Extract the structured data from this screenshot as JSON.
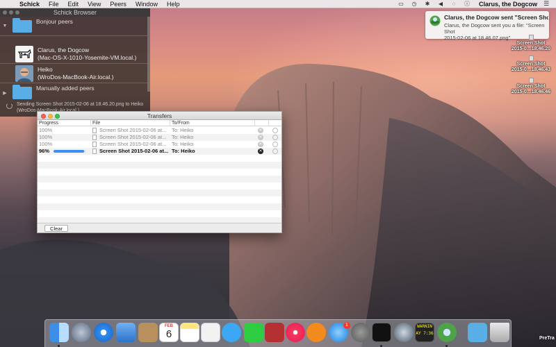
{
  "menubar": {
    "app_name": "Schick",
    "menus": [
      "File",
      "Edit",
      "View",
      "Peers",
      "Window",
      "Help"
    ],
    "user": "Clarus, the Dogcow"
  },
  "browser": {
    "title": "Schick Browser",
    "groups": [
      {
        "label": "Bonjour peers"
      },
      {
        "label": "Manually added peers"
      }
    ],
    "peers": [
      {
        "name": "Clarus, the Dogcow",
        "host": "(Mac-OS-X-1010-Yosemite-VM.local.)"
      },
      {
        "name": "Heiko",
        "host": "(WroDos-MacBook-Air.local.)"
      }
    ],
    "status_line1": "Sending Screen Shot 2015-02-06 at 18.46.20.png to Heiko",
    "status_line2": "(WroDos-MacBook-Air.local.)"
  },
  "notification": {
    "title": "Clarus, the Dogcow sent \"Screen Sho…",
    "body_line1": "Clarus, the Dogcow sent you a file: \"Screen Shot",
    "body_line2": "2015-02-06 at 18.46.07.png\""
  },
  "desktop_files": [
    {
      "line1": "Screen Shot",
      "line2": "2015-0…18.46.20"
    },
    {
      "line1": "Screen Shot",
      "line2": "2015-0…18.46.43"
    },
    {
      "line1": "Screen Shot",
      "line2": "2015-0…18.46.46"
    }
  ],
  "transfers": {
    "title": "Transfers",
    "columns": {
      "progress": "Progress",
      "file": "File",
      "to_from": "To/From"
    },
    "rows": [
      {
        "progress_label": "100%",
        "progress": 1.0,
        "file": "Screen Shot 2015-02-06 at...",
        "to_from": "To: Heiko",
        "active": false
      },
      {
        "progress_label": "100%",
        "progress": 1.0,
        "file": "Screen Shot 2015-02-06 at...",
        "to_from": "To: Heiko",
        "active": false
      },
      {
        "progress_label": "100%",
        "progress": 1.0,
        "file": "Screen Shot 2015-02-06 at...",
        "to_from": "To: Heiko",
        "active": false
      },
      {
        "progress_label": "96%",
        "progress": 0.96,
        "file": "Screen Shot 2015-02-06 at...",
        "to_from": "To: Heiko",
        "active": true
      }
    ],
    "clear_label": "Clear"
  },
  "dock": {
    "calendar_month": "FEB",
    "calendar_day": "6",
    "appstore_badge": "1",
    "console_text": "WARNIN",
    "console_time": "AY 7:36",
    "trash_label": "PreTra"
  },
  "colors": {
    "accent_blue": "#3a8ff0",
    "folder_blue": "#5aaee6",
    "close_red": "#fc605c",
    "minimize_yellow": "#fdbc40",
    "zoom_green": "#34c84a"
  }
}
